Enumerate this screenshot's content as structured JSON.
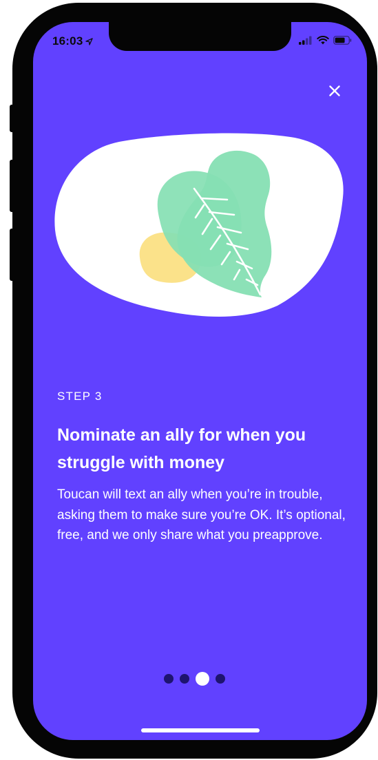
{
  "status_bar": {
    "time": "16:03",
    "location_icon": "location-arrow-icon",
    "signal_icon": "cellular-signal-icon",
    "wifi_icon": "wifi-icon",
    "battery_icon": "battery-icon"
  },
  "header": {
    "close_icon": "close-icon"
  },
  "onboarding": {
    "step_label": "STEP 3",
    "title": "Nominate an ally for when you struggle with money",
    "description": "Toucan will text an ally when you’re in trouble, asking them to make sure you’re OK. It’s optional, free, and we only share what you preapprove."
  },
  "pagination": {
    "total": 4,
    "current": 3
  },
  "colors": {
    "background": "#6141ff",
    "text": "#ffffff",
    "dot_inactive": "#1e1470",
    "dot_active": "#ffffff",
    "leaf": "#86dfb3",
    "blob": "#fbe28a",
    "bubble": "#ffffff"
  }
}
